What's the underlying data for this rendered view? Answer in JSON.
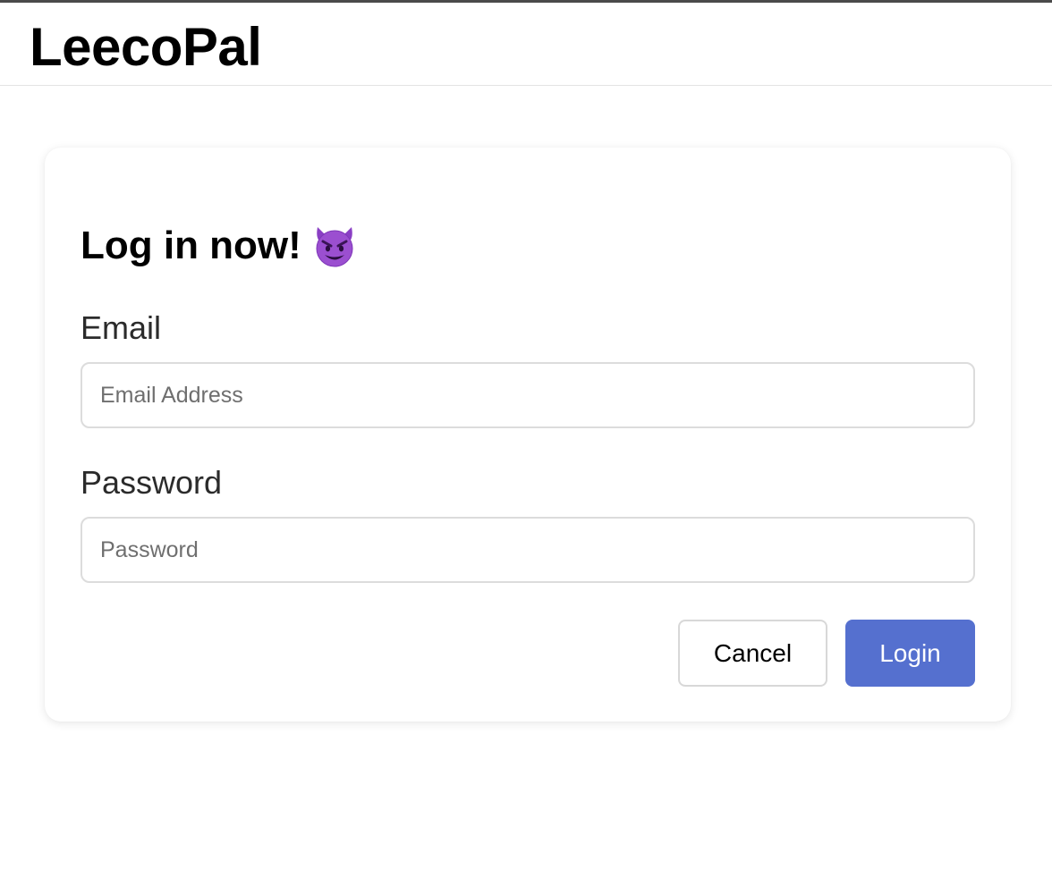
{
  "app": {
    "brand": "LeecoPal"
  },
  "login_card": {
    "heading": "Log in now!",
    "heading_icon": "smiling-face-with-horns-icon",
    "email": {
      "label": "Email",
      "placeholder": "Email Address",
      "value": ""
    },
    "password": {
      "label": "Password",
      "placeholder": "Password",
      "value": ""
    },
    "actions": {
      "cancel_label": "Cancel",
      "login_label": "Login"
    }
  },
  "colors": {
    "primary_button": "#5570cf",
    "devil_purple": "#9b4fd0"
  }
}
